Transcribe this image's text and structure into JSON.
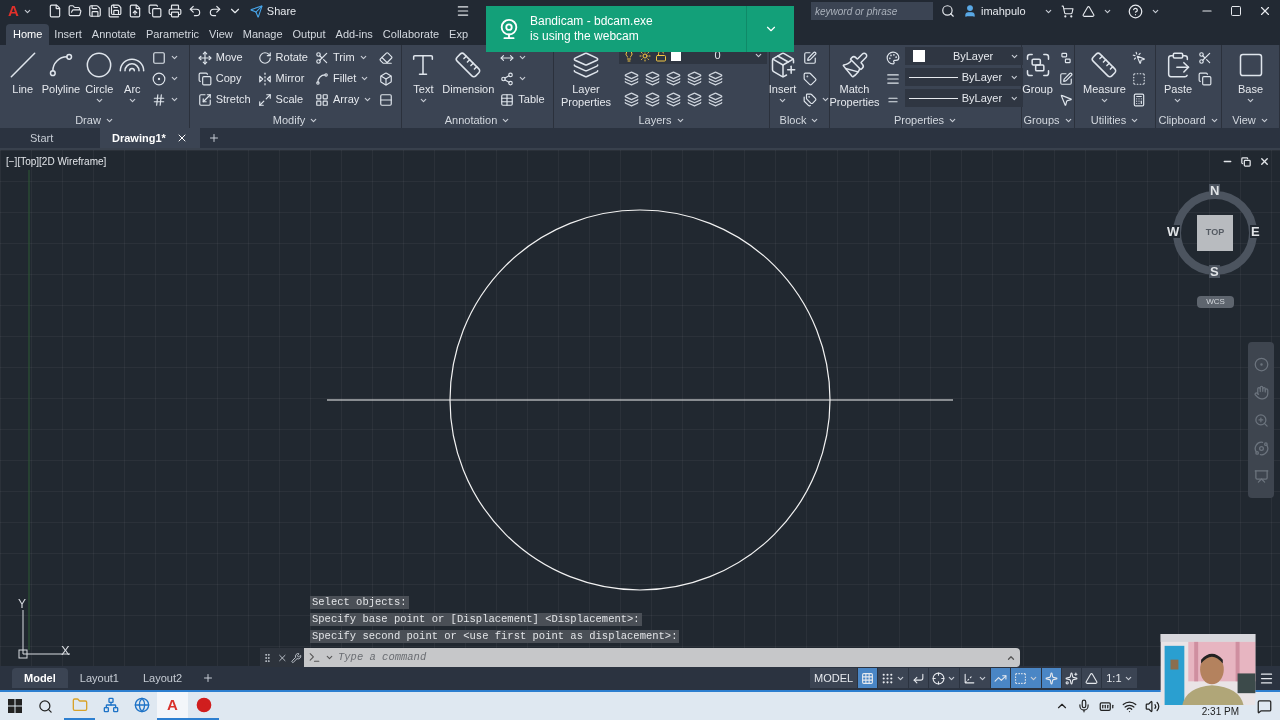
{
  "title_bar": {
    "logo": "A",
    "share": "Share",
    "search": {
      "placeholder": "keyword or phrase"
    },
    "user": "imahpulo"
  },
  "ribbon_tabs": [
    {
      "label": "Home",
      "selected": true
    },
    {
      "label": "Insert",
      "selected": false
    },
    {
      "label": "Annotate",
      "selected": false
    },
    {
      "label": "Parametric",
      "selected": false
    },
    {
      "label": "View",
      "selected": false
    },
    {
      "label": "Manage",
      "selected": false
    },
    {
      "label": "Output",
      "selected": false
    },
    {
      "label": "Add-ins",
      "selected": false
    },
    {
      "label": "Collaborate",
      "selected": false
    },
    {
      "label": "Exp",
      "selected": false
    }
  ],
  "panels": [
    {
      "title": "Draw",
      "columns": [
        [
          {
            "kind": "large",
            "label": "Line",
            "menu": false
          }
        ],
        [
          {
            "kind": "large",
            "label": "Polyline",
            "menu": false
          }
        ],
        [
          {
            "kind": "large",
            "label": "Circle",
            "menu": true
          }
        ],
        [
          {
            "kind": "large",
            "label": "Arc",
            "menu": true
          }
        ],
        [
          {
            "kind": "icon",
            "menu": true
          },
          {
            "kind": "icon",
            "menu": true
          },
          {
            "kind": "icon",
            "menu": true
          }
        ]
      ]
    },
    {
      "title": "Modify",
      "columns": [
        [
          {
            "kind": "small",
            "label": "Move",
            "menu": false
          },
          {
            "kind": "small",
            "label": "Copy",
            "menu": false
          },
          {
            "kind": "small",
            "label": "Stretch",
            "menu": false
          }
        ],
        [
          {
            "kind": "small",
            "label": "Rotate",
            "menu": false
          },
          {
            "kind": "small",
            "label": "Mirror",
            "menu": false
          },
          {
            "kind": "small",
            "label": "Scale",
            "menu": false
          }
        ],
        [
          {
            "kind": "small",
            "label": "Trim",
            "menu": true
          },
          {
            "kind": "small",
            "label": "Fillet",
            "menu": true
          },
          {
            "kind": "small",
            "label": "Array",
            "menu": true
          }
        ],
        [
          {
            "kind": "icon",
            "menu": false
          },
          {
            "kind": "icon",
            "menu": false
          },
          {
            "kind": "icon",
            "menu": false
          }
        ]
      ]
    },
    {
      "title": "Annotation",
      "columns": [
        [
          {
            "kind": "large",
            "label": "Text",
            "menu": true
          }
        ],
        [
          {
            "kind": "large",
            "label": "Dimension",
            "menu": false
          }
        ],
        [
          {
            "kind": "icon",
            "menu": true
          },
          {
            "kind": "icon",
            "menu": true
          },
          {
            "kind": "small",
            "label": "Table",
            "menu": false
          }
        ]
      ]
    },
    {
      "title": "Layers",
      "columns": [
        [
          {
            "kind": "large",
            "label": "Layer Properties",
            "menu": false
          }
        ],
        [
          {
            "kind": "layer",
            "value": "0"
          },
          {
            "kind": "icon_row"
          },
          {
            "kind": "icon_row"
          }
        ]
      ]
    },
    {
      "title": "Block",
      "columns": [
        [
          {
            "kind": "large",
            "label": "Insert",
            "menu": true
          }
        ],
        [
          {
            "kind": "icon",
            "menu": false
          },
          {
            "kind": "icon",
            "menu": false
          },
          {
            "kind": "icon",
            "menu": true
          }
        ]
      ]
    },
    {
      "title": "Properties",
      "columns": [
        [
          {
            "kind": "large",
            "label": "Match Properties",
            "menu": false
          }
        ],
        [
          {
            "kind": "icon",
            "menu": false
          },
          {
            "kind": "icon",
            "menu": false
          },
          {
            "kind": "icon",
            "menu": false
          }
        ],
        [
          {
            "kind": "color_dropdown",
            "value": "ByLayer"
          },
          {
            "kind": "line_dropdown",
            "value": "ByLayer"
          },
          {
            "kind": "line_dropdown",
            "value": "ByLayer"
          }
        ]
      ]
    },
    {
      "title": "Groups",
      "columns": [
        [
          {
            "kind": "large",
            "label": "Group",
            "menu": false
          }
        ],
        [
          {
            "kind": "icon",
            "menu": false
          },
          {
            "kind": "icon",
            "menu": false
          },
          {
            "kind": "icon",
            "menu": false
          }
        ]
      ]
    },
    {
      "title": "Utilities",
      "columns": [
        [
          {
            "kind": "large",
            "label": "Measure",
            "menu": true
          }
        ],
        [
          {
            "kind": "icon",
            "menu": false
          },
          {
            "kind": "icon",
            "menu": false
          },
          {
            "kind": "icon",
            "menu": false
          }
        ]
      ]
    },
    {
      "title": "Clipboard",
      "columns": [
        [
          {
            "kind": "large",
            "label": "Paste",
            "menu": true
          }
        ],
        [
          {
            "kind": "icon",
            "menu": false
          },
          {
            "kind": "icon",
            "menu": false
          }
        ]
      ]
    },
    {
      "title": "View",
      "columns": [
        [
          {
            "kind": "large",
            "label": "Base",
            "menu": true
          }
        ]
      ]
    }
  ],
  "toast": {
    "title": "Bandicam - bdcam.exe",
    "text": "is using the webcam"
  },
  "file_tabs": [
    {
      "label": "Start",
      "selected": false
    },
    {
      "label": "Drawing1*",
      "selected": true
    }
  ],
  "viewport": {
    "label": "[−][Top][2D Wireframe]"
  },
  "viewcube": {
    "north": "N",
    "south": "S",
    "east": "E",
    "west": "W",
    "face": "TOP",
    "ucs": "WCS"
  },
  "ucs_icon": {
    "y": "Y",
    "x": "X"
  },
  "command_history": [
    "Select objects:",
    "Specify base point or [Displacement] <Displacement>:",
    "Specify second point or <use first point as displacement>:"
  ],
  "command_line": {
    "placeholder": "Type a command"
  },
  "layout_tabs": [
    {
      "label": "Model",
      "selected": true
    },
    {
      "label": "Layout1",
      "selected": false
    },
    {
      "label": "Layout2",
      "selected": false
    }
  ],
  "status_bar": {
    "model": "MODEL",
    "scale": "1:1",
    "toggles": [
      {
        "on": true,
        "menu": false
      },
      {
        "on": false,
        "menu": true
      },
      {
        "on": false,
        "menu": false
      },
      {
        "on": false,
        "menu": true
      },
      {
        "on": false,
        "menu": true
      },
      {
        "on": true,
        "menu": false
      },
      {
        "on": true,
        "menu": true
      },
      {
        "on": true,
        "menu": false
      },
      {
        "on": false,
        "menu": false
      },
      {
        "on": false,
        "menu": false
      }
    ]
  },
  "taskbar": {
    "apps": [
      {
        "running": true,
        "active": false
      },
      {
        "running": false,
        "active": false
      },
      {
        "running": false,
        "active": false
      },
      {
        "label": "A",
        "running": true,
        "active": true
      },
      {
        "running": true,
        "active": false
      }
    ],
    "time": "2:31 PM"
  }
}
